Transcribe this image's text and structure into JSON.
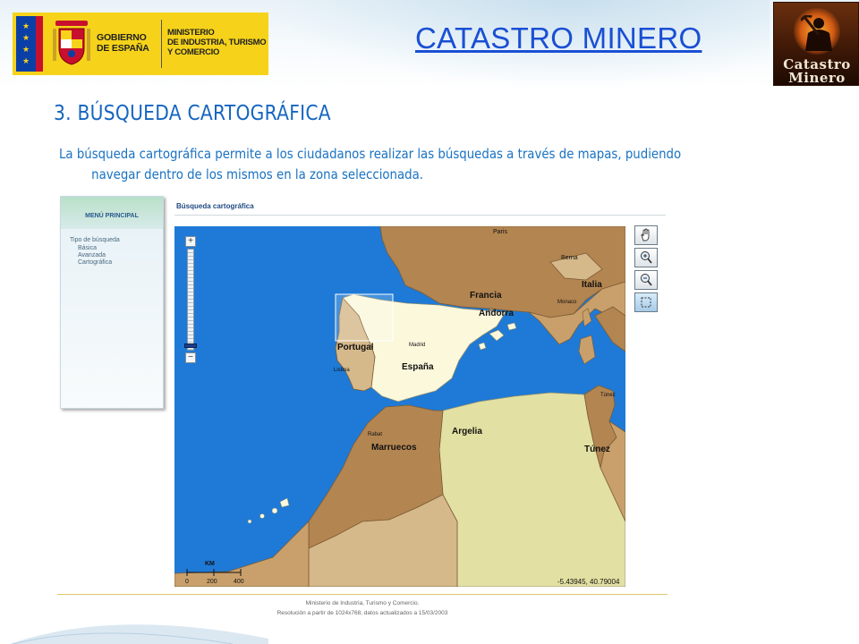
{
  "header": {
    "gov_logo": {
      "gobierno": "GOBIERNO",
      "de_espana": "DE ESPAÑA",
      "ministerio": "MINISTERIO",
      "industria": "DE INDUSTRIA, TURISMO",
      "comercio": "Y COMERCIO"
    },
    "title": "CATASTRO MINERO",
    "corner_logo": {
      "line1": "Catastro",
      "line2": "Minero"
    }
  },
  "section": {
    "title": "3. BÚSQUEDA CARTOGRÁFICA",
    "intro_line1": "La búsqueda cartográfica permite a los ciudadanos realizar las búsquedas a través de mapas, pudiendo",
    "intro_line2": "navegar dentro de los mismos en la zona seleccionada."
  },
  "app": {
    "menu": {
      "title": "MENÚ PRINCIPAL",
      "search_type_label": "Tipo de búsqueda",
      "items": [
        "Básica",
        "Avanzada",
        "Cartográfica"
      ]
    },
    "panel_title": "Búsqueda cartográfica",
    "map": {
      "labels": {
        "paris": "Paris",
        "berna": "Berna",
        "francia": "Francia",
        "andorra": "Andorra",
        "italia": "Italia",
        "monaco": "Monaco",
        "portugal": "Portugal",
        "lisboa": "Lisboa",
        "madrid": "Madrid",
        "espana": "España",
        "rabat": "Rabat",
        "marruecos": "Marruecos",
        "argelia": "Argelia",
        "tunez": "Túnez",
        "tunes_city": "Túnez"
      },
      "scale": {
        "unit": "KM",
        "ticks": [
          "0",
          "200",
          "400"
        ]
      },
      "coordinates": "-5.43945, 40.79004"
    },
    "tools": [
      "pan-hand-icon",
      "zoom-in-icon",
      "zoom-out-icon",
      "select-box-icon"
    ],
    "footer_line1": "Ministerio de Industria, Turismo y Comercio.",
    "footer_line2": "Resolución a partir de 1024x768, datos actualizados a 15/03/2003"
  },
  "colors": {
    "title_blue": "#1a4fd4",
    "section_blue": "#1565c0",
    "text_blue": "#1a72c2",
    "sea": "#1e7ad6",
    "spain": "#fbf8dc",
    "neighbor": "#b38551",
    "algeria": "#e2e0a2",
    "gov_yellow": "#f6d31a"
  }
}
